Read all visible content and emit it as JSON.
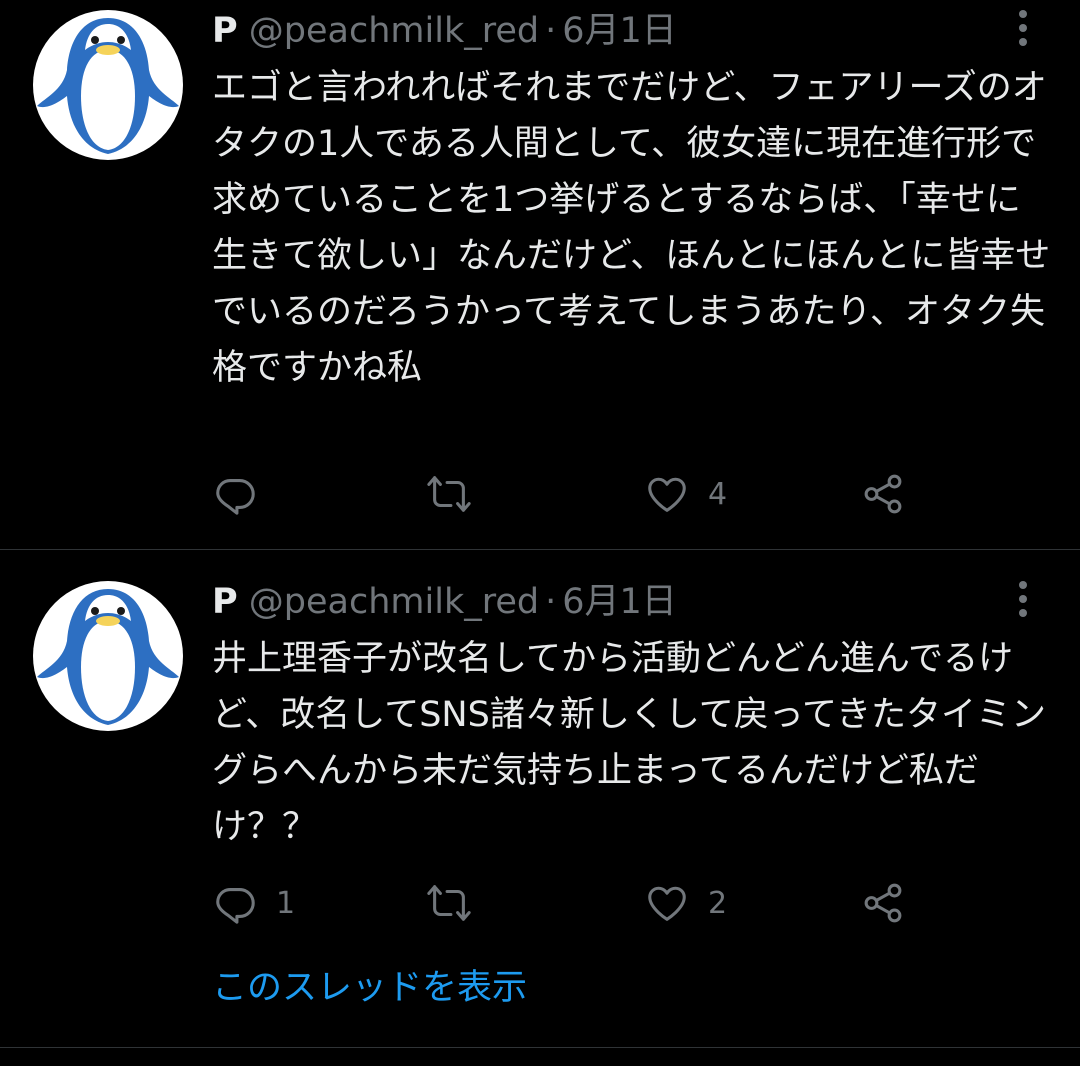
{
  "colors": {
    "background": "#000000",
    "text_primary": "#e7e9ea",
    "text_secondary": "#71767b",
    "divider": "#2f3336",
    "link": "#1d9bf0",
    "avatar_penguin_blue": "#2d6fc2",
    "avatar_beak": "#f5d35a"
  },
  "tweets": [
    {
      "author_name": "P",
      "handle": "@peachmilk_red",
      "separator": "·",
      "date": "6月1日",
      "avatar_icon": "penguin-avatar",
      "more_icon": "vertical-dots-icon",
      "text": "エゴと言われればそれまでだけど、フェアリーズのオタクの1人である人間として、彼女達に現在進行形で求めていることを1つ挙げるとするならば、「幸せに生きて欲しい」なんだけど、ほんとにほんとに皆幸せでいるのだろうかって考えてしまうあたり、オタク失格ですかね私",
      "reply_count": "",
      "retweet_count": "",
      "like_count": "4"
    },
    {
      "author_name": "P",
      "handle": "@peachmilk_red",
      "separator": "·",
      "date": "6月1日",
      "avatar_icon": "penguin-avatar",
      "more_icon": "vertical-dots-icon",
      "text": "井上理香子が改名してから活動どんどん進んでるけど、改名してSNS諸々新しくして戻ってきたタイミングらへんから未だ気持ち止まってるんだけど私だけ？？",
      "reply_count": "1",
      "retweet_count": "",
      "like_count": "2"
    }
  ],
  "thread_link": "このスレッドを表示"
}
